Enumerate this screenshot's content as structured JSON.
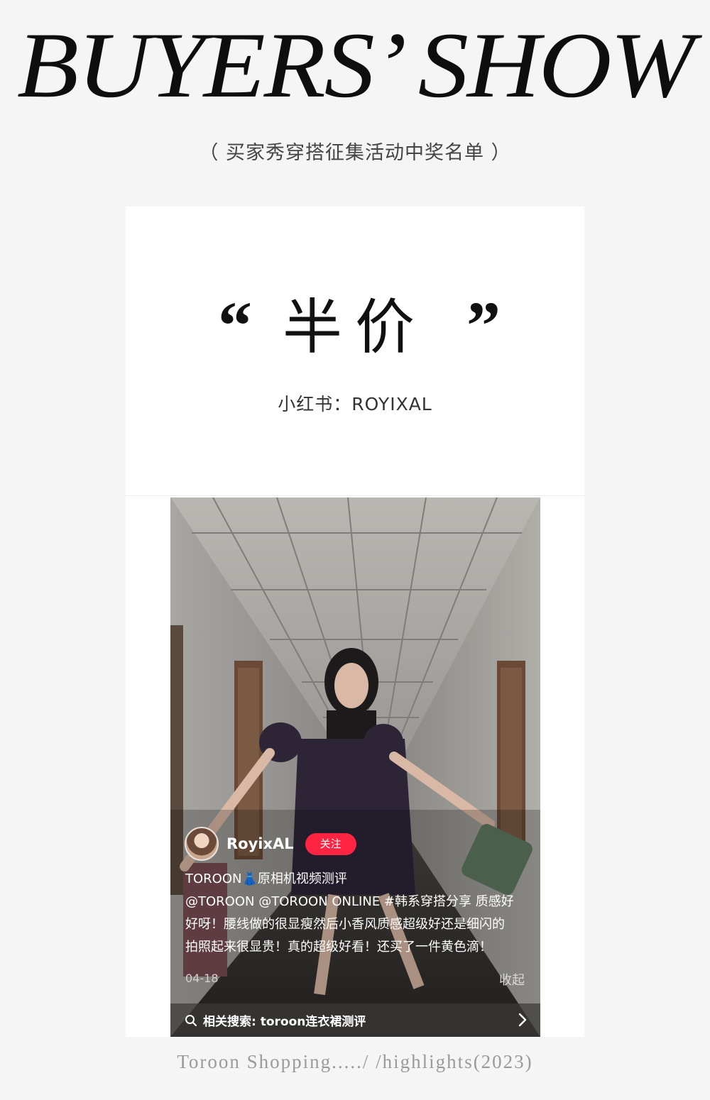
{
  "header": {
    "headline": "BUYERS’ SHOW",
    "subtitle": "（ 买家秀穿搭征集活动中奖名单 ）"
  },
  "card": {
    "quote_open": "“",
    "word": "半价",
    "quote_close": "”",
    "source": "小红书：ROYIXAL"
  },
  "post": {
    "username": "RoyixAL",
    "follow_label": "关注",
    "lines": [
      "TOROON👗原相机视频测评",
      "@TOROON @TOROON ONLINE #韩系穿搭分享  质感好",
      "好呀！腰线做的很显瘦然后小香风质感超级好还是细闪的",
      "拍照起来很显贵！真的超级好看！还买了一件黄色滴！"
    ],
    "date": "04-18",
    "collapse_label": "收起",
    "related_search": "相关搜索: toroon连衣裙测评"
  },
  "footer": {
    "text": "Toroon Shopping...../ /highlights(2023)"
  },
  "colors": {
    "background": "#f5f5f5",
    "follow_button": "#ff2442",
    "card": "#ffffff"
  }
}
